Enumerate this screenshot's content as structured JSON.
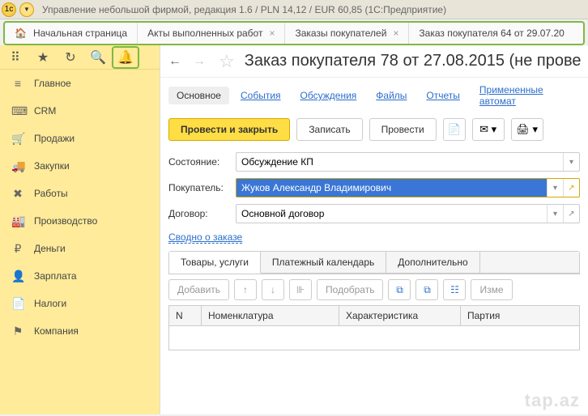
{
  "window_title": "Управление небольшой фирмой, редакция 1.6 / PLN 14,12 / EUR 60,85 (1С:Предприятие)",
  "top_tabs": {
    "home": "Начальная страница",
    "t1": "Акты выполненных работ",
    "t2": "Заказы покупателей",
    "overflow": "Заказ покупателя 64 от 29.07.20"
  },
  "nav": [
    {
      "label": "Главное",
      "icon": "≡"
    },
    {
      "label": "CRM",
      "icon": "⌨"
    },
    {
      "label": "Продажи",
      "icon": "🛒"
    },
    {
      "label": "Закупки",
      "icon": "🚚"
    },
    {
      "label": "Работы",
      "icon": "✖"
    },
    {
      "label": "Производство",
      "icon": "🏭"
    },
    {
      "label": "Деньги",
      "icon": "₽"
    },
    {
      "label": "Зарплата",
      "icon": "👤"
    },
    {
      "label": "Налоги",
      "icon": "📄"
    },
    {
      "label": "Компания",
      "icon": "⚑"
    }
  ],
  "document": {
    "title": "Заказ покупателя 78 от 27.08.2015 (не прове",
    "tabs": [
      "Основное",
      "События",
      "Обсуждения",
      "Файлы",
      "Отчеты",
      "Примененные автомат"
    ],
    "actions": {
      "main": "Провести и закрыть",
      "save": "Записать",
      "post": "Провести"
    },
    "fields": {
      "state_label": "Состояние:",
      "state_value": "Обсуждение КП",
      "buyer_label": "Покупатель:",
      "buyer_value": "Жуков Александр Владимирович",
      "contract_label": "Договор:",
      "contract_value": "Основной договор"
    },
    "summary_link": "Сводно о заказе",
    "inner_tabs": [
      "Товары, услуги",
      "Платежный календарь",
      "Дополнительно"
    ],
    "grid_toolbar": {
      "add": "Добавить",
      "pick": "Подобрать",
      "edit": "Изме"
    },
    "grid_cols": [
      "N",
      "Номенклатура",
      "Характеристика",
      "Партия"
    ]
  },
  "watermark": "tap.az"
}
